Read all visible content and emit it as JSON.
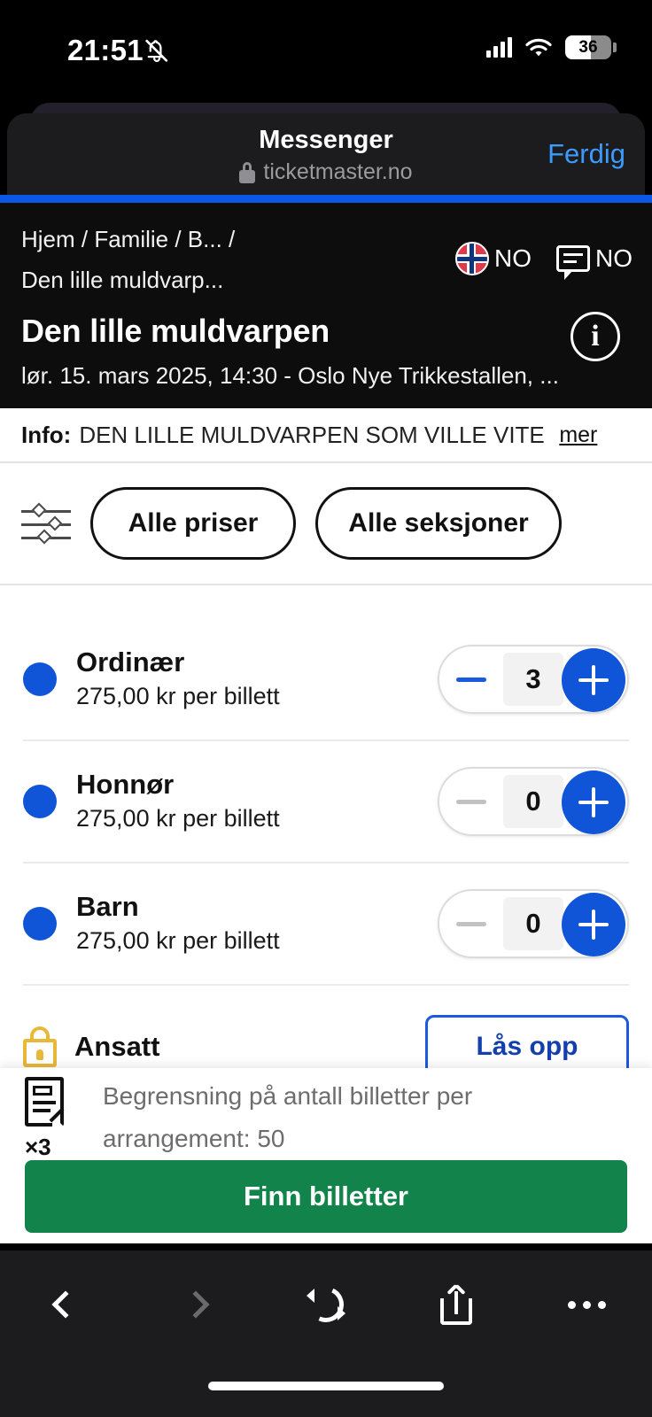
{
  "status_bar": {
    "time": "21:51",
    "mute_icon": "bell-slash-icon",
    "signal_icon": "cellular-signal-icon",
    "wifi_icon": "wifi-icon",
    "battery_percent": "36"
  },
  "in_app_browser": {
    "app_title": "Messenger",
    "lock_icon": "lock-icon",
    "url": "ticketmaster.no",
    "done_label": "Ferdig",
    "progress_color": "#0a57e8"
  },
  "event_header": {
    "breadcrumb_line1": "Hjem / Familie / B... /",
    "breadcrumb_line2": "Den lille muldvarp...",
    "title": "Den lille muldvarpen",
    "meta": "lør. 15. mars 2025, 14:30 -  Oslo Nye Trikkestallen, ...",
    "language": {
      "flag_icon": "norway-flag-icon",
      "flag_label": "NO",
      "chat_icon": "chat-bubble-icon",
      "chat_label": "NO"
    },
    "info_icon_label": "i"
  },
  "info_strip": {
    "label": "Info:",
    "text": "DEN LILLE MULDVARPEN SOM VILLE VITE ...",
    "more_label": "mer"
  },
  "filters": {
    "filter_icon": "sliders-filter-icon",
    "chips": [
      {
        "label": "Alle priser"
      },
      {
        "label": "Alle seksjoner"
      }
    ]
  },
  "ticket_types": [
    {
      "name": "Ordinær",
      "price": "275,00 kr per billett",
      "quantity": "3",
      "minus_enabled": true,
      "locked": false
    },
    {
      "name": "Honnør",
      "price": "275,00 kr per billett",
      "quantity": "0",
      "minus_enabled": false,
      "locked": false
    },
    {
      "name": "Barn",
      "price": "275,00 kr per billett",
      "quantity": "0",
      "minus_enabled": false,
      "locked": false
    },
    {
      "name": "Ansatt",
      "price": "",
      "quantity": "",
      "minus_enabled": false,
      "locked": true,
      "unlock_label": "Lås opp",
      "lock_icon": "lock-icon"
    }
  ],
  "footer": {
    "ticket_icon": "ticket-document-icon",
    "quantity_badge": "×3",
    "limit_text": "Begrensning på antall billetter per arrangement: 50",
    "cta_label": "Finn billetter",
    "cta_color": "#11834b"
  },
  "browser_toolbar": {
    "back_icon": "chevron-left-icon",
    "forward_icon": "chevron-right-icon",
    "reload_icon": "reload-icon",
    "share_icon": "share-icon",
    "more_icon": "ellipsis-icon"
  },
  "colors": {
    "accent_blue": "#1055d8",
    "link_blue": "#3b9bff",
    "green": "#11834b",
    "lock_gold": "#e8b838"
  }
}
